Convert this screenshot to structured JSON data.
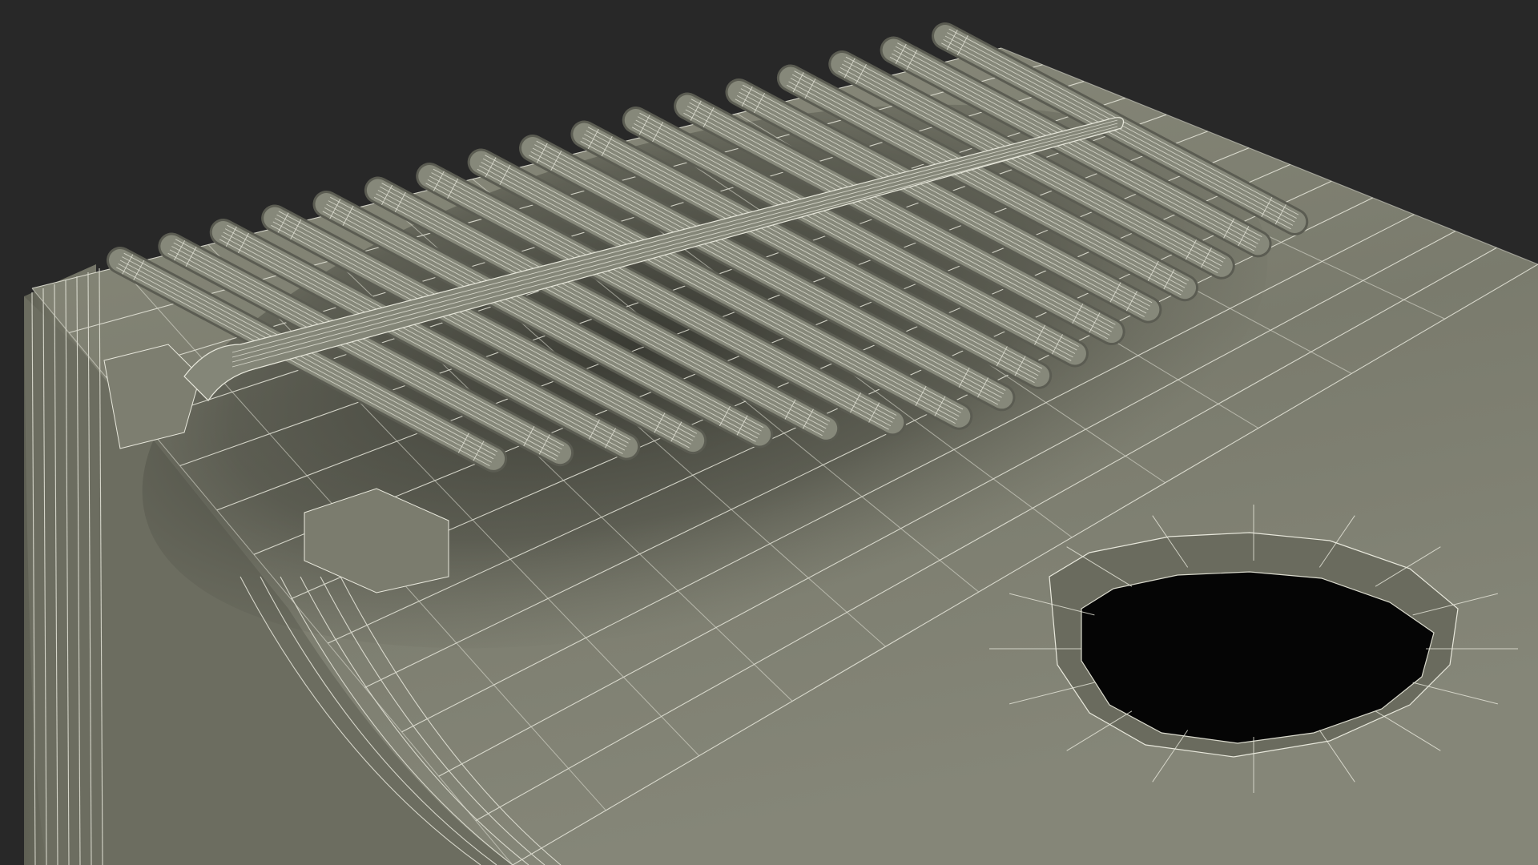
{
  "scene": {
    "subject": "kalimba-wireframe-render",
    "tine_count": 17,
    "colors": {
      "background": "#282828",
      "body_top": "#7f8071",
      "body_top_light": "#8c8d7e",
      "body_top_shadow": "#4a4b42",
      "body_side": "#6f7062",
      "body_side_dark": "#5a5b50",
      "tine": "#86887a",
      "tine_edge": "#5b5c52",
      "wire": "#e8e8dc",
      "hole": "#050505",
      "hole_rim": "#6a6b5e"
    }
  }
}
